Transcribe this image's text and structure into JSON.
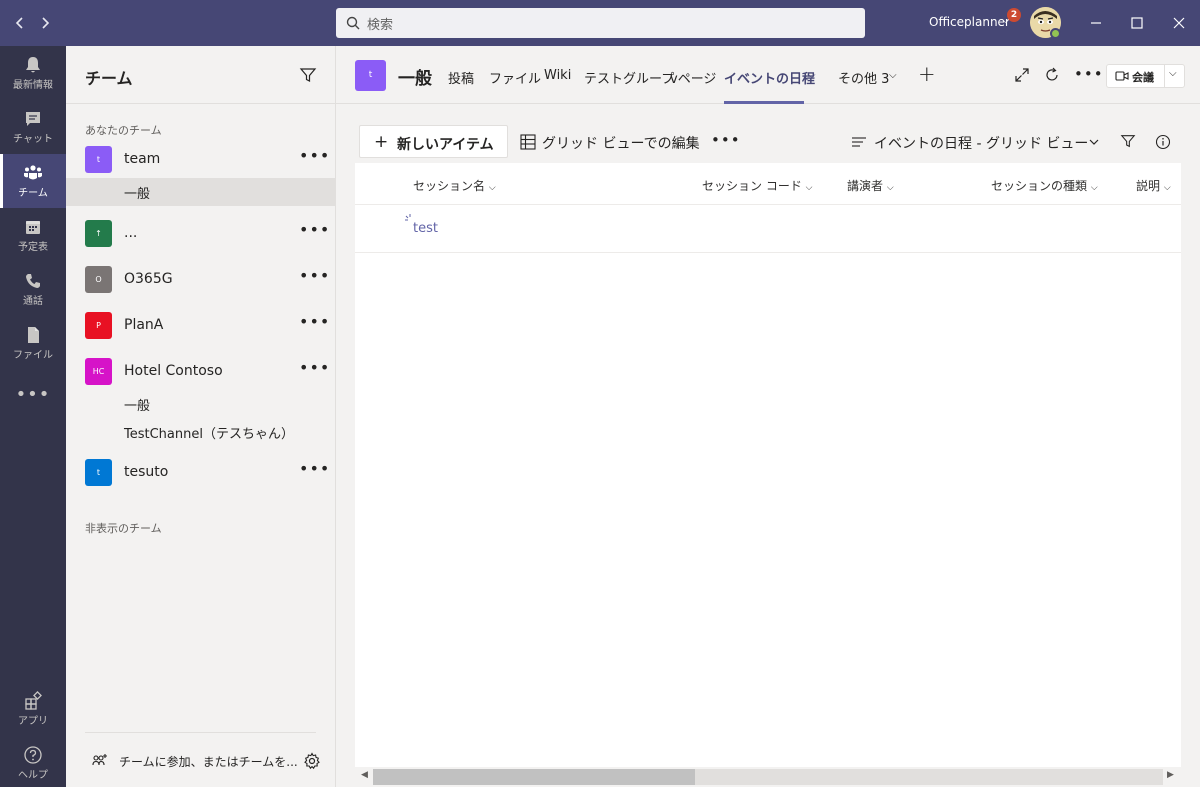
{
  "titlebar": {
    "back_icon": "chevron-left",
    "forward_icon": "chevron-right",
    "search_placeholder": "検索",
    "org_name": "Officeplanner",
    "org_badge": "2",
    "window_controls": [
      "minimize",
      "maximize",
      "close"
    ]
  },
  "rail": {
    "items": [
      {
        "label": "最新情報",
        "icon": "bell-icon"
      },
      {
        "label": "チャット",
        "icon": "chat-icon"
      },
      {
        "label": "チーム",
        "icon": "teams-icon",
        "active": true
      },
      {
        "label": "予定表",
        "icon": "calendar-icon"
      },
      {
        "label": "通話",
        "icon": "phone-icon"
      },
      {
        "label": "ファイル",
        "icon": "file-icon"
      }
    ],
    "more": "•••",
    "apps_label": "アプリ",
    "help_label": "ヘルプ"
  },
  "teams_panel": {
    "title": "チーム",
    "your_teams_label": "あなたのチーム",
    "hidden_teams_label": "非表示のチーム",
    "teams": [
      {
        "initials": "t",
        "name": "team",
        "color": "#8b5cf6",
        "channels": [
          "一般"
        ]
      },
      {
        "initials": "↑",
        "name": "...",
        "color": "#237b4b",
        "channels": []
      },
      {
        "initials": "O",
        "name": "O365G",
        "color": "#7a7574",
        "channels": []
      },
      {
        "initials": "P",
        "name": "PlanA",
        "color": "#e81123",
        "channels": []
      },
      {
        "initials": "HC",
        "name": "Hotel Contoso",
        "color": "#d613c8",
        "channels": [
          "一般",
          "TestChannel（テスちゃん）"
        ]
      },
      {
        "initials": "t",
        "name": "tesuto",
        "color": "#0078d4",
        "channels": []
      }
    ],
    "more_label": "•••",
    "join_label": "チームに参加、またはチームを..."
  },
  "channel": {
    "tile": "t",
    "name": "一般",
    "tabs": [
      "投稿",
      "ファイル",
      "Wiki",
      "テストグループ",
      "vページ",
      "イベントの日程",
      "その他 3"
    ],
    "active_tab": "イベントの日程",
    "more_label": "•••",
    "meet_label": "会議"
  },
  "list": {
    "new_item_label": "新しいアイテム",
    "grid_edit_label": "グリッド ビューでの編集",
    "more_label": "•••",
    "view_label": "イベントの日程 - グリッド ビュー",
    "columns": [
      "セッション名",
      "セッション コード",
      "講演者",
      "セッションの種類",
      "説明"
    ],
    "rows": [
      {
        "title": "test"
      }
    ]
  },
  "colors": {
    "titlebar": "#464775",
    "rail": "#33344a",
    "accent": "#6264a7"
  }
}
